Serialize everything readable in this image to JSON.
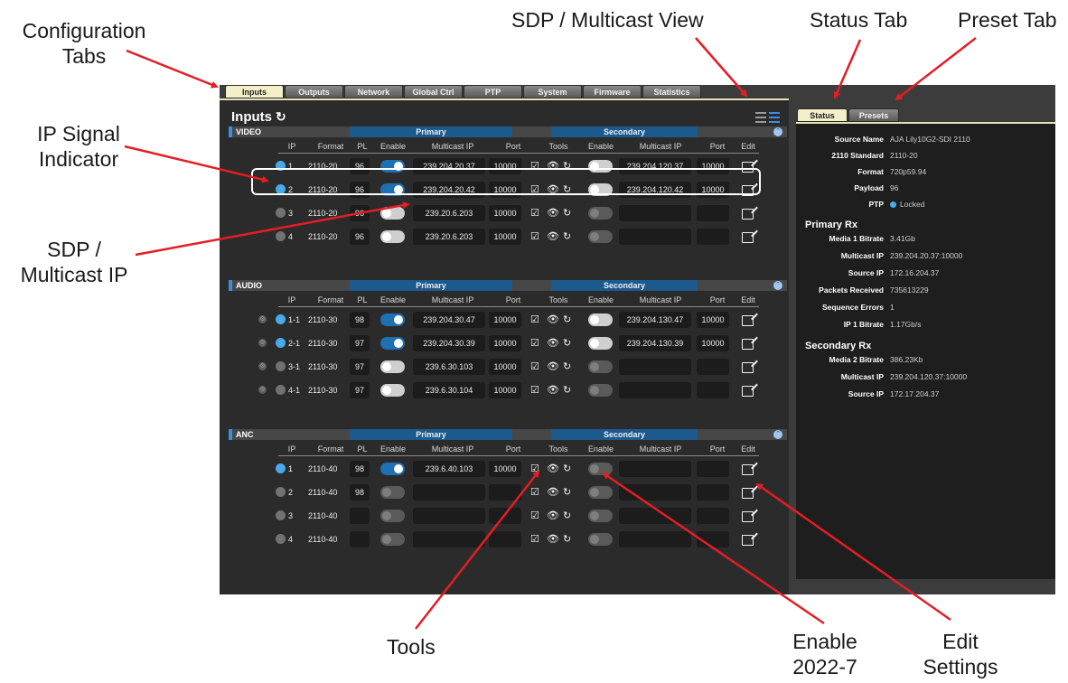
{
  "callouts": {
    "config_tabs": [
      "Configuration",
      "Tabs"
    ],
    "sdp_view": "SDP / Multicast View",
    "status_tab": "Status Tab",
    "preset_tab": "Preset Tab",
    "ip_signal": [
      "IP Signal",
      "Indicator"
    ],
    "sdp_ip": [
      "SDP /",
      "Multicast IP"
    ],
    "tools": "Tools",
    "enable": [
      "Enable",
      "2022-7"
    ],
    "edit": [
      "Edit",
      "Settings"
    ]
  },
  "tabs": [
    "Inputs",
    "Outputs",
    "Network",
    "Global Ctrl",
    "PTP",
    "System",
    "Firmware",
    "Statistics"
  ],
  "active_tab": "Inputs",
  "main_title": "Inputs",
  "refresh_glyph": "↻",
  "band_primary": "Primary",
  "band_secondary": "Secondary",
  "columns": {
    "ip": "IP",
    "format": "Format",
    "pl": "PL",
    "enable": "Enable",
    "mcast": "Multicast IP",
    "port": "Port",
    "tools": "Tools",
    "enable2": "Enable",
    "mcast2": "Multicast IP",
    "port2": "Port",
    "edit": "Edit"
  },
  "tool_glyphs": {
    "sdp": "☑",
    "view": "👁",
    "refresh": "↻",
    "gear": "⚙"
  },
  "sections": [
    {
      "label": "VIDEO",
      "rows": [
        {
          "ip": "1",
          "format": "2110-20",
          "pl": "96",
          "en": "on",
          "mcast": "239.204.20.37",
          "port": "10000",
          "en2": "off",
          "mcast2": "239.204.120.37",
          "port2": "10000",
          "signal": true
        },
        {
          "ip": "2",
          "format": "2110-20",
          "pl": "96",
          "en": "on",
          "mcast": "239.204.20.42",
          "port": "10000",
          "en2": "off",
          "mcast2": "239.204.120.42",
          "port2": "10000",
          "signal": true
        },
        {
          "ip": "3",
          "format": "2110-20",
          "pl": "96",
          "en": "off",
          "mcast": "239.20.6.203",
          "port": "10000",
          "en2": "dis",
          "mcast2": "",
          "port2": "",
          "signal": false
        },
        {
          "ip": "4",
          "format": "2110-20",
          "pl": "96",
          "en": "off",
          "mcast": "239.20.6.203",
          "port": "10000",
          "en2": "dis",
          "mcast2": "",
          "port2": "",
          "signal": false
        }
      ]
    },
    {
      "label": "AUDIO",
      "rows": [
        {
          "ip": "1-1",
          "format": "2110-30",
          "pl": "98",
          "en": "on",
          "mcast": "239.204.30.47",
          "port": "10000",
          "en2": "off",
          "mcast2": "239.204.130.47",
          "port2": "10000",
          "signal": true
        },
        {
          "ip": "2-1",
          "format": "2110-30",
          "pl": "97",
          "en": "on",
          "mcast": "239.204.30.39",
          "port": "10000",
          "en2": "off",
          "mcast2": "239.204.130.39",
          "port2": "10000",
          "signal": true
        },
        {
          "ip": "3-1",
          "format": "2110-30",
          "pl": "97",
          "en": "off",
          "mcast": "239.6.30.103",
          "port": "10000",
          "en2": "dis",
          "mcast2": "",
          "port2": "",
          "signal": false
        },
        {
          "ip": "4-1",
          "format": "2110-30",
          "pl": "97",
          "en": "off",
          "mcast": "239.6.30.104",
          "port": "10000",
          "en2": "dis",
          "mcast2": "",
          "port2": "",
          "signal": false
        }
      ]
    },
    {
      "label": "ANC",
      "rows": [
        {
          "ip": "1",
          "format": "2110-40",
          "pl": "98",
          "en": "on",
          "mcast": "239.6.40.103",
          "port": "10000",
          "en2": "dis",
          "mcast2": "",
          "port2": "",
          "signal": true
        },
        {
          "ip": "2",
          "format": "2110-40",
          "pl": "98",
          "en": "dis",
          "mcast": "",
          "port": "",
          "en2": "dis",
          "mcast2": "",
          "port2": "",
          "signal": false
        },
        {
          "ip": "3",
          "format": "2110-40",
          "pl": "",
          "en": "dis",
          "mcast": "",
          "port": "",
          "en2": "dis",
          "mcast2": "",
          "port2": "",
          "signal": false
        },
        {
          "ip": "4",
          "format": "2110-40",
          "pl": "",
          "en": "dis",
          "mcast": "",
          "port": "",
          "en2": "dis",
          "mcast2": "",
          "port2": "",
          "signal": false
        }
      ]
    }
  ],
  "side_tabs": [
    "Status",
    "Presets"
  ],
  "status": {
    "items": [
      {
        "k": "Source Name",
        "v": "AJA Lily10G2-SDI 2110"
      },
      {
        "k": "2110 Standard",
        "v": "2110-20"
      },
      {
        "k": "Format",
        "v": "720p59.94"
      },
      {
        "k": "Payload",
        "v": "96"
      },
      {
        "k": "PTP",
        "v": "Locked"
      }
    ],
    "primary_head": "Primary Rx",
    "primary": [
      {
        "k": "Media 1 Bitrate",
        "v": "3.41Gb"
      },
      {
        "k": "Multicast IP",
        "v": "239.204.20.37:10000"
      },
      {
        "k": "Source IP",
        "v": "172.16.204.37"
      },
      {
        "k": "Packets Received",
        "v": "735613229"
      },
      {
        "k": "Sequence Errors",
        "v": "1"
      },
      {
        "k": "IP 1 Bitrate",
        "v": "1.17Gb/s"
      }
    ],
    "secondary_head": "Secondary Rx",
    "secondary": [
      {
        "k": "Media 2 Bitrate",
        "v": "386.23Kb"
      },
      {
        "k": "Multicast IP",
        "v": "239.204.120.37:10000"
      },
      {
        "k": "Source IP",
        "v": "172.17.204.37"
      }
    ]
  }
}
